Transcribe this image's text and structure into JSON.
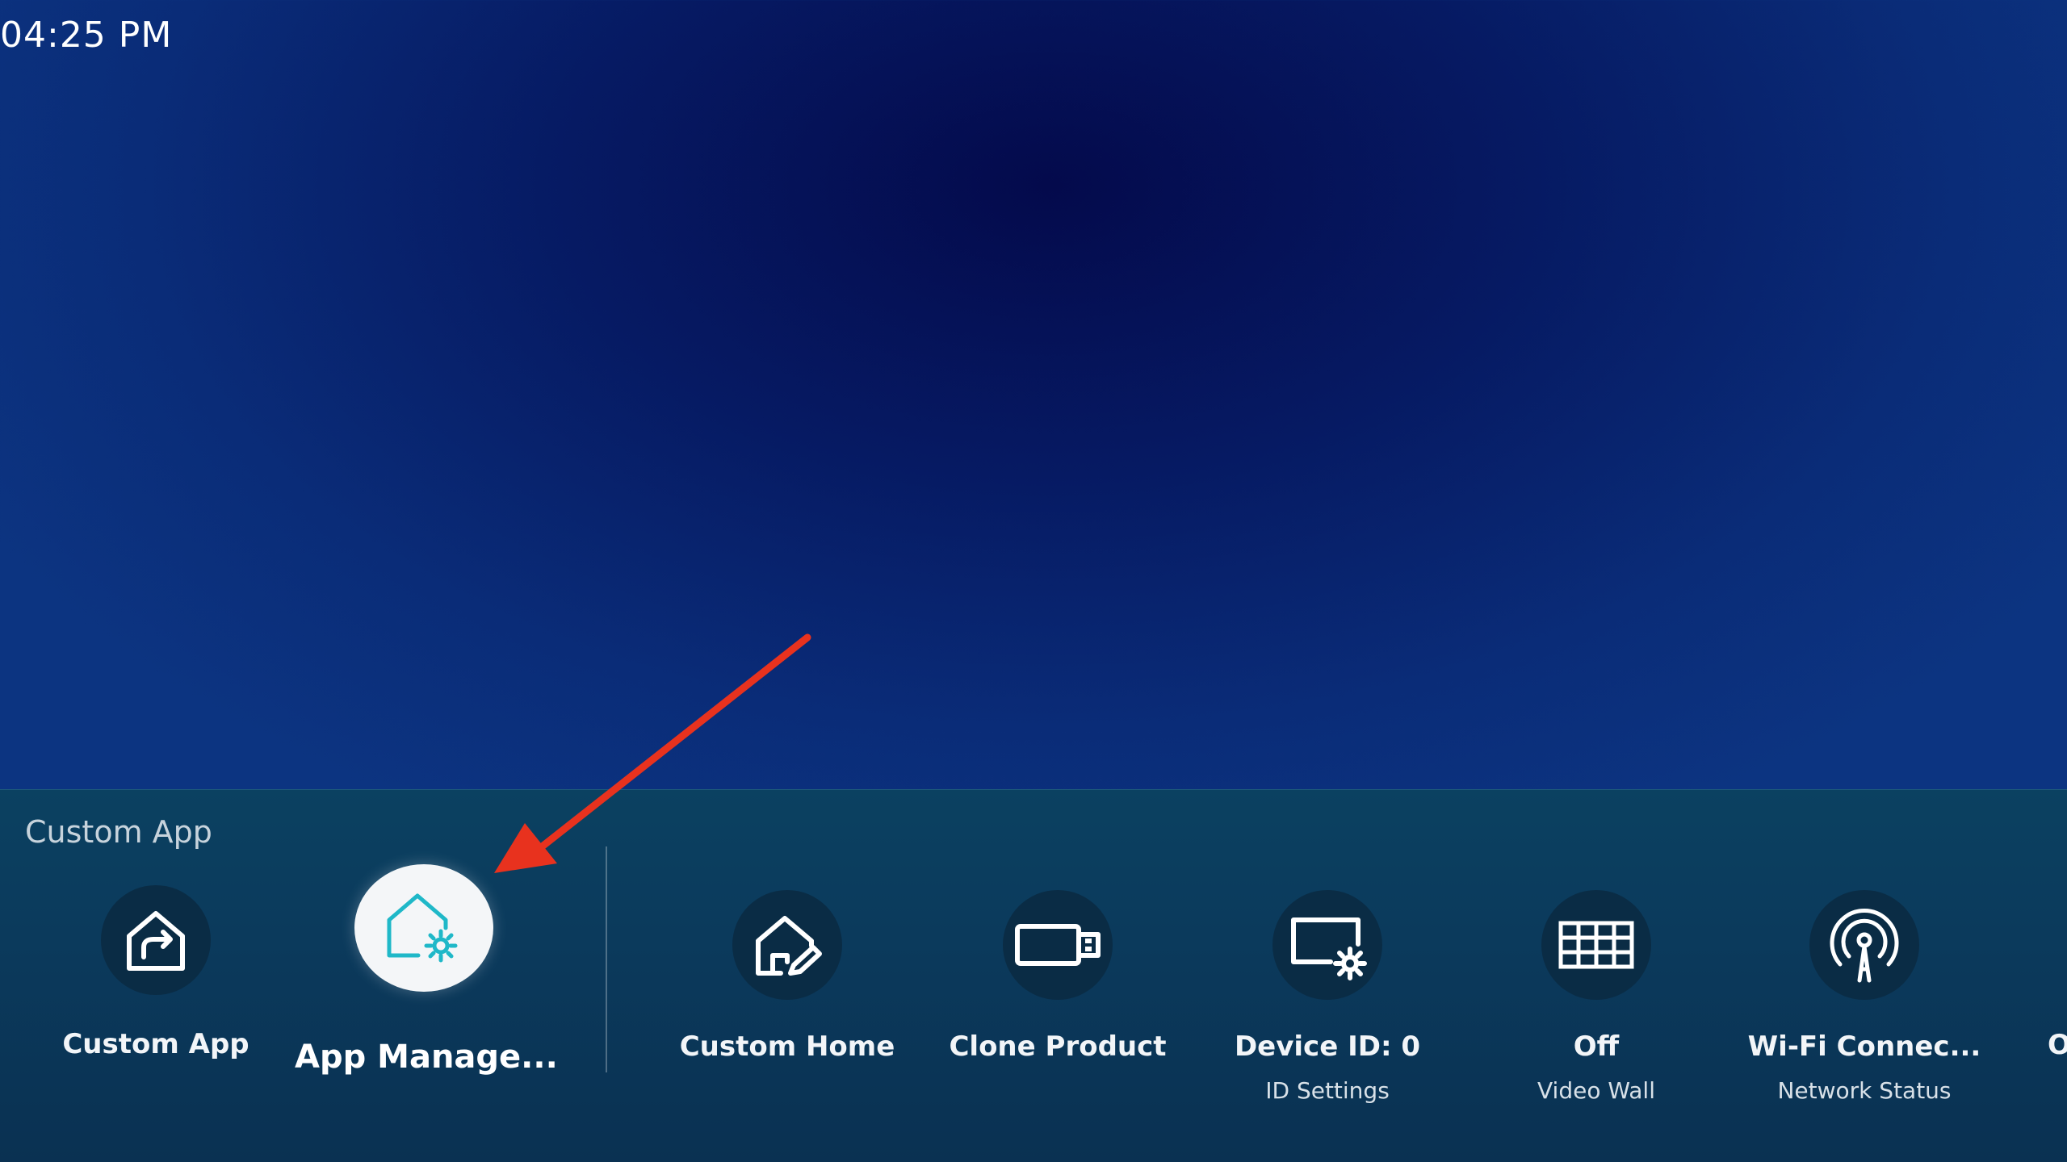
{
  "status_bar": {
    "time": "04:25 PM"
  },
  "panel": {
    "title": "Custom App",
    "items": [
      {
        "icon": "custom-app-icon",
        "label": "Custom App",
        "sub": ""
      },
      {
        "icon": "app-management-icon",
        "label": "App Manage...",
        "sub": "",
        "focused": true
      },
      {
        "icon": "custom-home-icon",
        "label": "Custom Home",
        "sub": ""
      },
      {
        "icon": "clone-product-icon",
        "label": "Clone Product",
        "sub": ""
      },
      {
        "icon": "device-settings-icon",
        "label": "Device ID: 0",
        "sub": "ID Settings"
      },
      {
        "icon": "video-wall-icon",
        "label": "Off",
        "sub": "Video Wall"
      },
      {
        "icon": "wifi-antenna-icon",
        "label": "Wi-Fi Connec...",
        "sub": "Network Status"
      }
    ],
    "cutoff_label": "O"
  },
  "colors": {
    "accent_teal": "#1fb8c8",
    "annotation_arrow": "#e8321e",
    "focused_circle": "#f4f6f8"
  }
}
